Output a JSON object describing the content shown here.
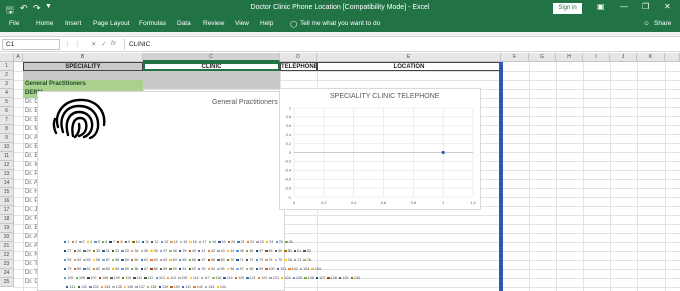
{
  "window": {
    "title": "Doctor Clinic Phone Location  [Compatibility Mode]  -  Excel",
    "signin_label": "Sign in",
    "share_label": "Share",
    "tell_me": "Tell me what you want to do"
  },
  "ribbon_tabs": [
    "File",
    "Home",
    "Insert",
    "Page Layout",
    "Formulas",
    "Data",
    "Review",
    "View",
    "Help"
  ],
  "formula_bar": {
    "name_box": "C1",
    "fx": "fx",
    "content": "CLINIC"
  },
  "columns": [
    "A",
    "B",
    "C",
    "D",
    "E",
    "F",
    "G",
    "H",
    "I",
    "J",
    "K"
  ],
  "rows": [
    "1",
    "2",
    "3",
    "4",
    "5",
    "6",
    "7",
    "8",
    "9",
    "10",
    "11",
    "12",
    "13",
    "14",
    "15",
    "16",
    "17",
    "18",
    "19",
    "20",
    "21",
    "22",
    "23",
    "24",
    "25"
  ],
  "header_cells": {
    "speciality": "SPECIALITY",
    "clinic": "CLINIC",
    "telephone": "TELEPHONE",
    "location": "LOCATION"
  },
  "row3_label": "General Practitioners",
  "row4_label": "DERM",
  "doctor_cells": [
    "Dr. Gr",
    "Dr. Br",
    "Dr. El",
    "Dr. M",
    "Dr. Al",
    "Dr. Br",
    "Dr. Bo",
    "Dr. Ie",
    "Dr. P",
    "Dr. Al",
    "Dr. Ho",
    "Dr. Pr",
    "Dr. Ja",
    "Dr. Ro",
    "Dr. Br",
    "Dr. Al",
    "Dr. Al",
    "Dr. Ni",
    "Dr. Ti",
    "Dr. Ta",
    "Dr. Ch"
  ],
  "chart1": {
    "title": "General Practitioners"
  },
  "chart2": {
    "title": "SPECIALITY CLINIC TELEPHONE",
    "y_ticks": [
      "1",
      "0.8",
      "0.6",
      "0.4",
      "0.2",
      "0",
      "-0.2",
      "-0.4",
      "-0.6",
      "-0.8",
      "-1"
    ],
    "x_ticks": [
      "0",
      "0.2",
      "0.4",
      "0.6",
      "0.8",
      "1",
      "1.2"
    ]
  },
  "chart_data": [
    {
      "type": "pie",
      "title": "General Practitioners",
      "legend_entries": [
        "1",
        "2",
        "3",
        "4",
        "5",
        "6",
        "7",
        "8",
        "9",
        "10",
        "11",
        "12",
        "13",
        "14",
        "15",
        "16",
        "17",
        "18",
        "19",
        "20",
        "21",
        "22",
        "23",
        "24",
        "25",
        "26",
        "27",
        "28",
        "29",
        "30",
        "31",
        "32",
        "33",
        "34",
        "35",
        "36",
        "37",
        "38",
        "39",
        "40",
        "41",
        "42",
        "43",
        "44",
        "45",
        "46",
        "47",
        "48",
        "49",
        "50",
        "51",
        "52",
        "53",
        "54",
        "55",
        "56",
        "57",
        "58",
        "59",
        "60",
        "61",
        "62",
        "63",
        "64",
        "65",
        "66",
        "67",
        "68",
        "69",
        "70",
        "71",
        "72",
        "73",
        "74",
        "75",
        "76",
        "77",
        "78",
        "79",
        "80",
        "81",
        "82",
        "83",
        "84",
        "85",
        "86",
        "87",
        "88",
        "89",
        "90",
        "91",
        "92",
        "93",
        "94",
        "95",
        "96",
        "97",
        "98",
        "99",
        "100",
        "101",
        "102",
        "103",
        "104",
        "105",
        "106",
        "107",
        "108",
        "109",
        "110",
        "111",
        "112",
        "113",
        "114",
        "115",
        "116",
        "117",
        "118",
        "119",
        "120",
        "121",
        "122",
        "123",
        "124",
        "125",
        "126",
        "127",
        "128",
        "129",
        "130",
        "131",
        "132",
        "133",
        "134",
        "135",
        "136",
        "137",
        "138",
        "139",
        "140",
        "141",
        "142",
        "143",
        "144"
      ],
      "legend": "bottom"
    },
    {
      "type": "scatter",
      "title": "SPECIALITY CLINIC TELEPHONE",
      "x": [
        1
      ],
      "y": [
        0
      ],
      "xlim": [
        0,
        1.2
      ],
      "ylim": [
        -1,
        1
      ],
      "grid": true
    }
  ],
  "colors": {
    "excel_green": "#217346",
    "header_grey": "#c9c9c9",
    "row_green": "#a9d08e",
    "marker_blue": "#2f55b5"
  }
}
